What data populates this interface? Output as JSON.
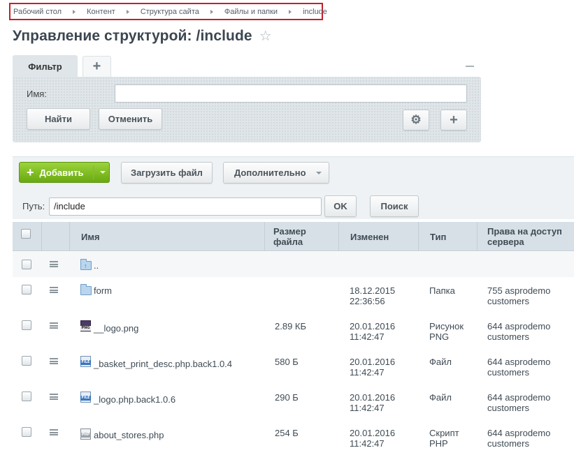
{
  "breadcrumb": [
    "Рабочий стол",
    "Контент",
    "Структура сайта",
    "Файлы и папки",
    "include"
  ],
  "page_title": "Управление структурой: /include",
  "filter": {
    "tab_label": "Фильтр",
    "name_label": "Имя:",
    "name_value": "",
    "find_label": "Найти",
    "cancel_label": "Отменить"
  },
  "toolbar": {
    "add_label": "Добавить",
    "upload_label": "Загрузить файл",
    "more_label": "Дополнительно",
    "path_label": "Путь:",
    "path_value": "/include",
    "ok_label": "OK",
    "search_label": "Поиск"
  },
  "table": {
    "columns": {
      "name": "Имя",
      "size_line1": "Размер",
      "size_line2": "файла",
      "modified": "Изменен",
      "type": "Тип",
      "rights_line1": "Права на доступ",
      "rights_line2": "сервера"
    },
    "parent_label": "..",
    "rows": [
      {
        "name": "form",
        "size": "",
        "date": "18.12.2015",
        "time": "22:36:56",
        "type_line1": "Папка",
        "type_line2": "",
        "rights_line1": "755 asprodemo",
        "rights_line2": "customers"
      },
      {
        "name": "__logo.png",
        "size": "2.89 КБ",
        "date": "20.01.2016",
        "time": "11:42:47",
        "type_line1": "Рисунок",
        "type_line2": "PNG",
        "rights_line1": "644 asprodemo",
        "rights_line2": "customers"
      },
      {
        "name": "_basket_print_desc.php.back1.0.4",
        "size": "580 Б",
        "date": "20.01.2016",
        "time": "11:42:47",
        "type_line1": "Файл",
        "type_line2": "",
        "rights_line1": "644 asprodemo",
        "rights_line2": "customers"
      },
      {
        "name": "_logo.php.back1.0.6",
        "size": "290 Б",
        "date": "20.01.2016",
        "time": "11:42:47",
        "type_line1": "Файл",
        "type_line2": "",
        "rights_line1": "644 asprodemo",
        "rights_line2": "customers"
      },
      {
        "name": "about_stores.php",
        "size": "254 Б",
        "date": "20.01.2016",
        "time": "11:42:47",
        "type_line1": "Скрипт",
        "type_line2": "PHP",
        "rights_line1": "644 asprodemo",
        "rights_line2": "customers"
      }
    ]
  },
  "icons": {
    "file_tag": "FILE",
    "png_tag": "PNG",
    "php_tag": "PHP"
  },
  "colors": {
    "add_button": "#7ab51d",
    "breadcrumb_highlight": "#c81e25",
    "header_bg": "#d7e0e6",
    "link": "#2d5f92"
  }
}
